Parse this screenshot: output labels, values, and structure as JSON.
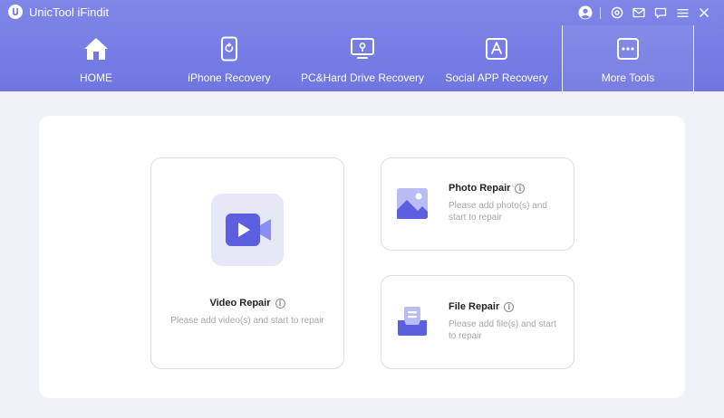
{
  "app": {
    "title": "UnicTool iFindit",
    "logo_icon": "unictool-logo-icon"
  },
  "window_controls": {
    "icons": [
      "account-icon",
      "settings-icon",
      "mail-icon",
      "feedback-icon",
      "menu-icon",
      "close-icon"
    ]
  },
  "nav": {
    "tabs": [
      {
        "label": "HOME",
        "icon": "home-icon",
        "active": false
      },
      {
        "label": "iPhone Recovery",
        "icon": "iphone-recovery-icon",
        "active": false
      },
      {
        "label": "PC&Hard Drive Recovery",
        "icon": "pc-recovery-icon",
        "active": false
      },
      {
        "label": "Social APP Recovery",
        "icon": "app-store-icon",
        "active": false
      },
      {
        "label": "More Tools",
        "icon": "more-tools-icon",
        "active": true
      }
    ]
  },
  "tools": {
    "video": {
      "title": "Video Repair",
      "description": "Please add video(s) and start to repair",
      "icon": "video-camera-icon"
    },
    "photo": {
      "title": "Photo Repair",
      "description": "Please add photo(s) and start to repair",
      "icon": "photo-icon"
    },
    "file": {
      "title": "File Repair",
      "description": "Please add file(s) and start to repair",
      "icon": "file-tray-icon"
    },
    "info_glyph": "i"
  },
  "colors": {
    "header_gradient_top": "#7f86e8",
    "header_gradient_bottom": "#6f76e0",
    "accent": "#5b5fe0",
    "page_background": "#f1f2f7"
  }
}
